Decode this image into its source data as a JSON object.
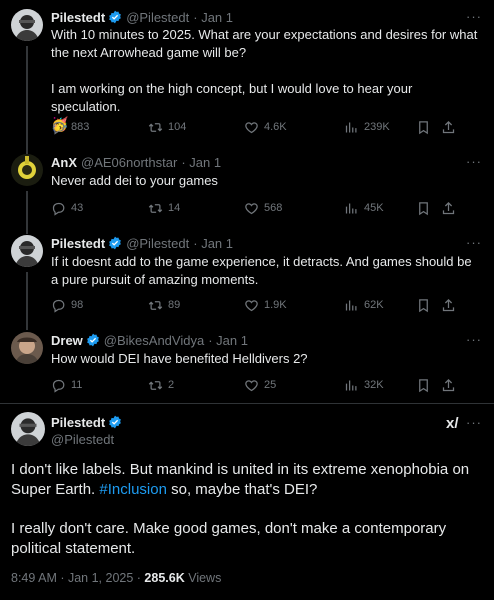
{
  "tweets": [
    {
      "name": "Pilestedt",
      "handle": "@Pilestedt",
      "time": "· Jan 1",
      "text_1": "With 10 minutes to 2025. What are your expectations and desires for what the next Arrowhead game will be?",
      "text_2": "I am working on the high concept, but I would love to hear your speculation.",
      "emoji": "🥳",
      "replies": "883",
      "reposts": "104",
      "likes": "4.6K",
      "views": "239K"
    },
    {
      "name": "AnX",
      "handle": "@AE06northstar",
      "time": "· Jan 1",
      "text": "Never add dei to your games",
      "replies": "43",
      "reposts": "14",
      "likes": "568",
      "views": "45K"
    },
    {
      "name": "Pilestedt",
      "handle": "@Pilestedt",
      "time": "· Jan 1",
      "text": "If it doesnt add to the game experience, it detracts. And games should be a pure pursuit of amazing moments.",
      "replies": "98",
      "reposts": "89",
      "likes": "1.9K",
      "views": "62K"
    },
    {
      "name": "Drew",
      "handle": "@BikesAndVidya",
      "time": "· Jan 1",
      "text": "How would DEI have benefited Helldivers 2?",
      "replies": "11",
      "reposts": "2",
      "likes": "25",
      "views": "32K"
    }
  ],
  "main_tweet": {
    "name": "Pilestedt",
    "handle": "@Pilestedt",
    "para_1_a": "I don't like labels. But mankind is united in its extreme xenophobia on Super Earth. ",
    "hashtag": "#Inclusion",
    "para_1_b": " so, maybe that's DEI?",
    "para_2": "I really don't care. Make good games, don't make a contemporary political statement.",
    "timestamp": "8:49 AM · Jan 1, 2025 · ",
    "views_count": "285.6K",
    "views_label": " Views"
  },
  "colors": {
    "background": "#000000",
    "text": "#e7e9ea",
    "muted": "#71767b",
    "accent": "#1d9bf0",
    "divider": "#2f3336"
  },
  "icons": [
    "reply-icon",
    "repost-icon",
    "like-icon",
    "views-icon",
    "bookmark-icon",
    "share-icon",
    "verified-icon",
    "more-icon",
    "grok-icon"
  ]
}
